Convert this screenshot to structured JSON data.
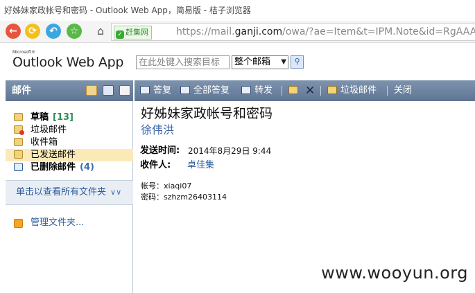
{
  "browser": {
    "window_title": "好姊妹家政帐号和密码 - Outlook Web App，简易版 - 桔子浏览器",
    "url_prefix": "https://mail.",
    "url_host": "ganji.com",
    "url_rest": "/owa/?ae=Item&t=IPM.Note&id=RgAAAA",
    "secure_badge": "赶集网",
    "nav_icons": [
      "back-icon",
      "forward-icon",
      "refresh-icon",
      "favorite-icon",
      "home-icon"
    ]
  },
  "owa": {
    "logo_small": "Microsoft®",
    "logo_main": "Outlook Web App",
    "search_placeholder": "在此处键入搜索目标",
    "scope_value": "整个邮箱"
  },
  "nav": {
    "title": "邮件",
    "folders": [
      {
        "label": "草稿",
        "count": "[13]"
      },
      {
        "label": "垃圾邮件",
        "count": ""
      },
      {
        "label": "收件箱",
        "count": ""
      },
      {
        "label": "已发送邮件",
        "count": ""
      },
      {
        "label": "已删除邮件",
        "count": "(4)"
      }
    ],
    "all_folders": "单击以查看所有文件夹",
    "manage_folders": "管理文件夹..."
  },
  "toolbar": {
    "reply": "答复",
    "reply_all": "全部答复",
    "forward": "转发",
    "junk": "垃圾邮件",
    "close": "关闭"
  },
  "message": {
    "subject": "好姊妹家政帐号和密码",
    "sender": "徐伟洪",
    "sent_label": "发送时间:",
    "sent_value": "2014年8月29日  9:44",
    "to_label": "收件人:",
    "to_value": "卓佳集",
    "body_lines": [
      "帐号：xiaqi07",
      "密码：szhzm26403114"
    ]
  },
  "watermark": "www.wooyun.org",
  "colors": {
    "header_bar": "#6b819e",
    "link": "#2d5d9c",
    "sender": "#3a63a6",
    "selected_folder": "#fbeab8"
  }
}
